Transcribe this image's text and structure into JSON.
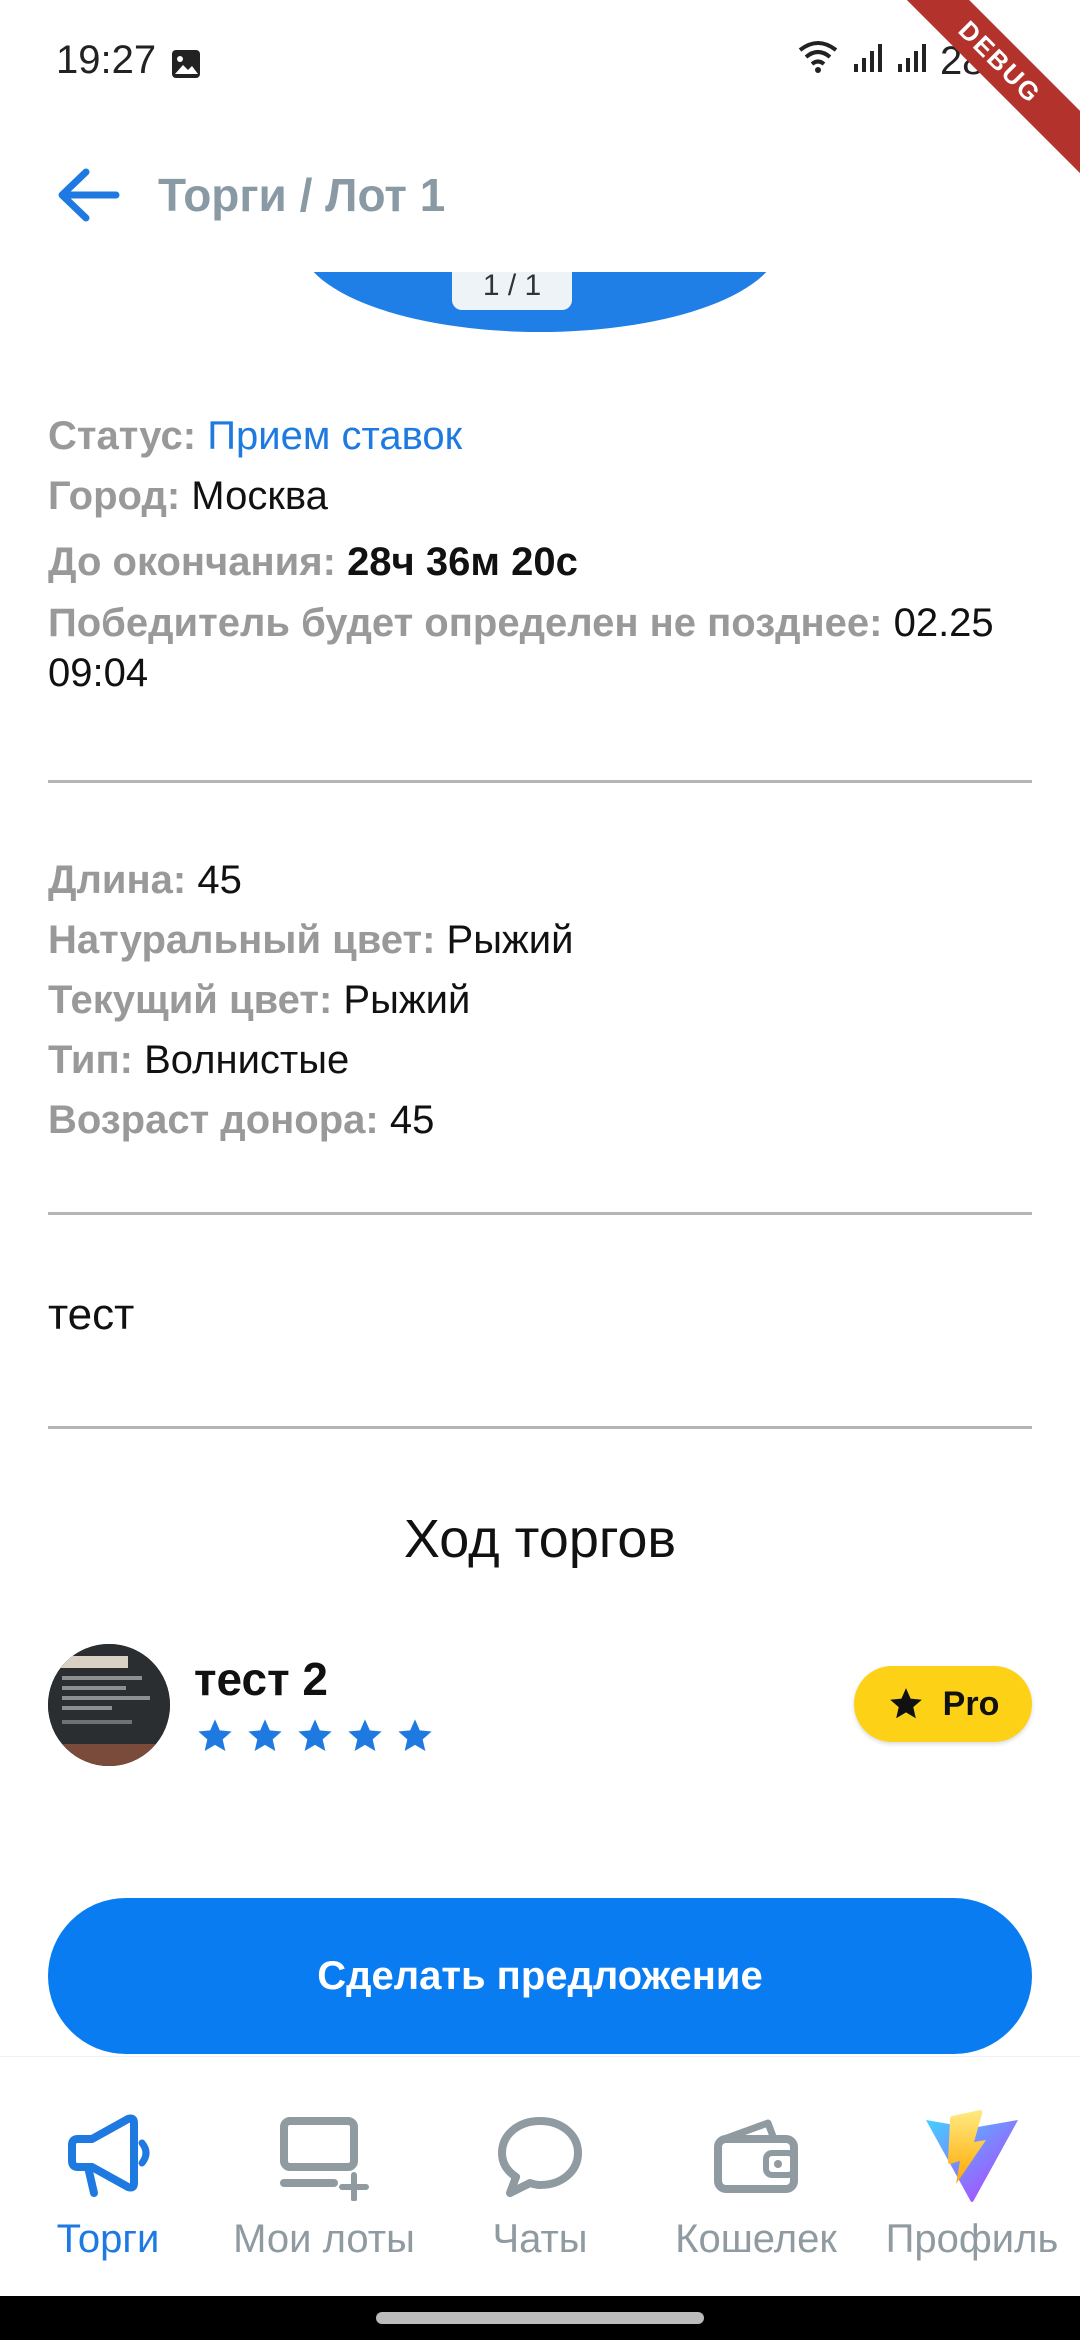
{
  "status_bar": {
    "time": "19:27",
    "battery": "28%",
    "debug_label": "DEBUG"
  },
  "app_bar": {
    "title": "Торги / Лот 1"
  },
  "photo": {
    "counter": "1 / 1"
  },
  "lot_info": {
    "status_label": "Статус:",
    "status_value": "Прием ставок",
    "city_label": "Город:",
    "city_value": "Москва",
    "ends_label": "До окончания:",
    "ends_value": "28ч 36м 20с",
    "winner_label": "Победитель будет определен не позднее:",
    "winner_value": "02.25 09:04"
  },
  "hair_info": {
    "length_label": "Длина:",
    "length_value": "45",
    "natural_color_label": "Натуральный цвет:",
    "natural_color_value": "Рыжий",
    "current_color_label": "Текущий цвет:",
    "current_color_value": "Рыжий",
    "type_label": "Тип:",
    "type_value": "Волнистые",
    "donor_age_label": "Возраст донора:",
    "donor_age_value": "45"
  },
  "description": "тест",
  "bidding": {
    "title": "Ход торгов",
    "bidder_name": "тест 2",
    "rating": 5,
    "badge": "Pro"
  },
  "offer_button": "Сделать предложение",
  "bottom_nav": {
    "items": [
      {
        "label": "Торги",
        "icon": "megaphone-icon",
        "active": true
      },
      {
        "label": "Мои лоты",
        "icon": "monitor-plus-icon",
        "active": false
      },
      {
        "label": "Чаты",
        "icon": "chat-bubble-icon",
        "active": false
      },
      {
        "label": "Кошелек",
        "icon": "wallet-icon",
        "active": false
      },
      {
        "label": "Профиль",
        "icon": "profile-logo-icon",
        "active": false
      }
    ]
  },
  "colors": {
    "accent": "#1e7ae0",
    "button": "#0a7cf2",
    "pro_badge": "#fcd116",
    "label_grey": "#999999"
  }
}
